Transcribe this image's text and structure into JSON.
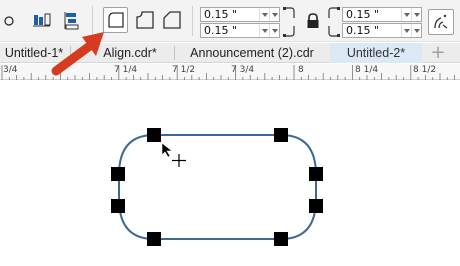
{
  "toolbar": {
    "corner_values": [
      "0.15 \"",
      "0.15 \"",
      "0.15 \"",
      "0.15 \""
    ],
    "tools": [
      "object-origin-icon",
      "align-horizontal-icon",
      "align-vertical-icon",
      "round-corner-icon",
      "scallop-corner-icon",
      "chamfer-corner-icon",
      "lock-icon",
      "scale-corners-icon"
    ]
  },
  "tabs": [
    {
      "label": "Untitled-1*",
      "active": false
    },
    {
      "label": "Align.cdr*",
      "active": false
    },
    {
      "label": "Announcement (2).cdr",
      "active": false
    },
    {
      "label": "Untitled-2*",
      "active": true
    }
  ],
  "add_tab_label": "+",
  "ruler": {
    "labels": [
      "3/4",
      "7 1/4",
      "7 1/2",
      "7 3/4",
      "8",
      "8 1/4",
      "8 1/2"
    ]
  },
  "colors": {
    "shape_outline": "#3d6a94",
    "handle": "#000000",
    "arrow": "#d63b22",
    "active_tab": "#dbe9f6"
  }
}
